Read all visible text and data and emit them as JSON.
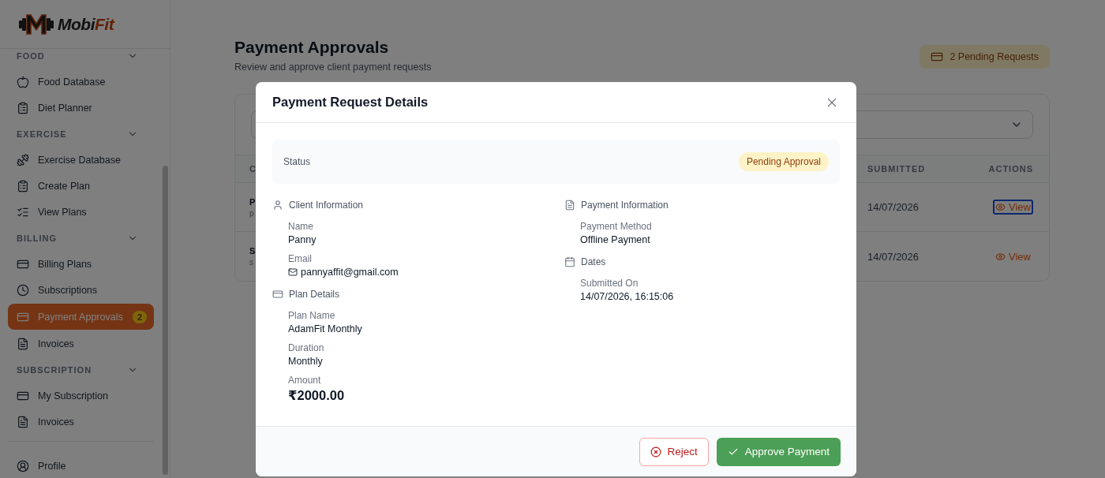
{
  "brand": {
    "first": "Mobi",
    "second": "Fit"
  },
  "sidebar": {
    "items": [
      {
        "kind": "section",
        "label": "FOOD",
        "expanded": true
      },
      {
        "kind": "item",
        "label": "Food Database",
        "selected": false
      },
      {
        "kind": "item",
        "label": "Diet Planner",
        "selected": false
      },
      {
        "kind": "section",
        "label": "EXERCISE",
        "expanded": true
      },
      {
        "kind": "item",
        "label": "Exercise Database",
        "selected": false
      },
      {
        "kind": "item",
        "label": "Create Plan",
        "selected": false
      },
      {
        "kind": "item",
        "label": "View Plans",
        "selected": false
      },
      {
        "kind": "section",
        "label": "BILLING",
        "expanded": true
      },
      {
        "kind": "item",
        "label": "Billing Plans",
        "selected": false
      },
      {
        "kind": "item",
        "label": "Subscriptions",
        "selected": false
      },
      {
        "kind": "item",
        "label": "Payment Approvals",
        "selected": true,
        "badge": "2"
      },
      {
        "kind": "item",
        "label": "Invoices",
        "selected": false
      },
      {
        "kind": "section",
        "label": "SUBSCRIPTION",
        "expanded": true
      },
      {
        "kind": "item",
        "label": "My Subscription",
        "selected": false
      },
      {
        "kind": "item",
        "label": "Invoices",
        "selected": false
      },
      {
        "kind": "divider"
      },
      {
        "kind": "item",
        "label": "Profile",
        "selected": false
      }
    ]
  },
  "page": {
    "title": "Payment Approvals",
    "subtitle": "Review and approve client payment requests",
    "pending": "2 Pending Requests"
  },
  "table": {
    "columns": [
      "C",
      "SUBMITTED",
      "ACTIONS"
    ],
    "rows": [
      {
        "column_1": "P",
        "column_1_sub": "p",
        "submitted": "14/07/2026",
        "action": "View",
        "focused": true
      },
      {
        "column_1": "S",
        "column_1_sub": "s",
        "submitted": "14/07/2026",
        "action": "View",
        "focused": false
      }
    ]
  },
  "modal": {
    "title": "Payment Request Details",
    "status_label": "Status",
    "status": "Pending Approval",
    "left": [
      {
        "heading": "Client Information",
        "fields": [
          {
            "kind": "text",
            "label": "Name",
            "value": "Panny"
          },
          {
            "kind": "email",
            "label": "Email",
            "value": "pannyaffit@gmail.com"
          }
        ]
      },
      {
        "heading": "Plan Details",
        "fields": [
          {
            "kind": "text",
            "label": "Plan Name",
            "value": "AdamFit Monthly"
          },
          {
            "kind": "text",
            "label": "Duration",
            "value": "Monthly"
          },
          {
            "kind": "amount",
            "label": "Amount",
            "value": "₹2000.00"
          }
        ]
      }
    ],
    "right": [
      {
        "heading": "Payment Information",
        "fields": [
          {
            "kind": "text",
            "label": "Payment Method",
            "value": "Offline Payment"
          }
        ]
      },
      {
        "heading": "Dates",
        "fields": [
          {
            "kind": "text",
            "label": "Submitted On",
            "value": "14/07/2026, 16:15:06"
          }
        ]
      }
    ],
    "reject": "Reject",
    "approve": "Approve Payment"
  }
}
